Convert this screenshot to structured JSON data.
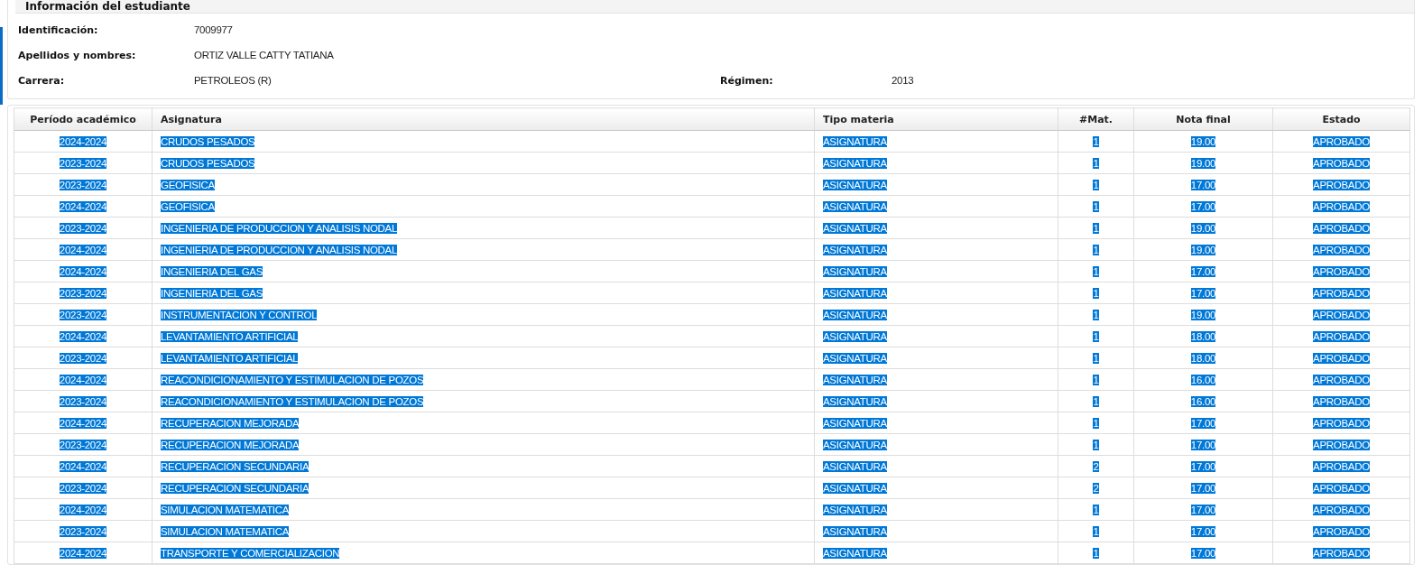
{
  "student_info": {
    "title": "Información del estudiante",
    "fields": [
      {
        "label": "Identificación:",
        "value": "7009977"
      },
      {
        "label": "Apellidos y nombres:",
        "value": "ORTIZ VALLE CATTY TATIANA"
      },
      {
        "label": "Carrera:",
        "value": "PETROLEOS (R)",
        "extra_label": "Régimen:",
        "extra_value": "2013"
      }
    ]
  },
  "table": {
    "text_highlighted": true,
    "columns": [
      "Período académico",
      "Asignatura",
      "Tipo materia",
      "#Mat.",
      "Nota final",
      "Estado"
    ],
    "rows": [
      [
        "2024-2024",
        "CRUDOS PESADOS",
        "ASIGNATURA",
        "1",
        "19.00",
        "APROBADO"
      ],
      [
        "2023-2024",
        "CRUDOS PESADOS",
        "ASIGNATURA",
        "1",
        "19.00",
        "APROBADO"
      ],
      [
        "2023-2024",
        "GEOFISICA",
        "ASIGNATURA",
        "1",
        "17.00",
        "APROBADO"
      ],
      [
        "2024-2024",
        "GEOFISICA",
        "ASIGNATURA",
        "1",
        "17.00",
        "APROBADO"
      ],
      [
        "2023-2024",
        "INGENIERIA DE PRODUCCION Y ANALISIS NODAL",
        "ASIGNATURA",
        "1",
        "19.00",
        "APROBADO"
      ],
      [
        "2024-2024",
        "INGENIERIA DE PRODUCCION Y ANALISIS NODAL",
        "ASIGNATURA",
        "1",
        "19.00",
        "APROBADO"
      ],
      [
        "2024-2024",
        "INGENIERIA DEL GAS",
        "ASIGNATURA",
        "1",
        "17.00",
        "APROBADO"
      ],
      [
        "2023-2024",
        "INGENIERIA DEL GAS",
        "ASIGNATURA",
        "1",
        "17.00",
        "APROBADO"
      ],
      [
        "2023-2024",
        "INSTRUMENTACION Y CONTROL",
        "ASIGNATURA",
        "1",
        "19.00",
        "APROBADO"
      ],
      [
        "2024-2024",
        "LEVANTAMIENTO ARTIFICIAL",
        "ASIGNATURA",
        "1",
        "18.00",
        "APROBADO"
      ],
      [
        "2023-2024",
        "LEVANTAMIENTO ARTIFICIAL",
        "ASIGNATURA",
        "1",
        "18.00",
        "APROBADO"
      ],
      [
        "2024-2024",
        "REACONDICIONAMIENTO Y ESTIMULACION DE POZOS",
        "ASIGNATURA",
        "1",
        "16.00",
        "APROBADO"
      ],
      [
        "2023-2024",
        "REACONDICIONAMIENTO Y ESTIMULACION DE POZOS",
        "ASIGNATURA",
        "1",
        "16.00",
        "APROBADO"
      ],
      [
        "2024-2024",
        "RECUPERACION MEJORADA",
        "ASIGNATURA",
        "1",
        "17.00",
        "APROBADO"
      ],
      [
        "2023-2024",
        "RECUPERACION MEJORADA",
        "ASIGNATURA",
        "1",
        "17.00",
        "APROBADO"
      ],
      [
        "2024-2024",
        "RECUPERACION SECUNDARIA",
        "ASIGNATURA",
        "2",
        "17.00",
        "APROBADO"
      ],
      [
        "2023-2024",
        "RECUPERACION SECUNDARIA",
        "ASIGNATURA",
        "2",
        "17.00",
        "APROBADO"
      ],
      [
        "2024-2024",
        "SIMULACION MATEMATICA",
        "ASIGNATURA",
        "1",
        "17.00",
        "APROBADO"
      ],
      [
        "2023-2024",
        "SIMULACION MATEMATICA",
        "ASIGNATURA",
        "1",
        "17.00",
        "APROBADO"
      ],
      [
        "2024-2024",
        "TRANSPORTE Y COMERCIALIZACION",
        "ASIGNATURA",
        "1",
        "17.00",
        "APROBADO"
      ]
    ]
  }
}
